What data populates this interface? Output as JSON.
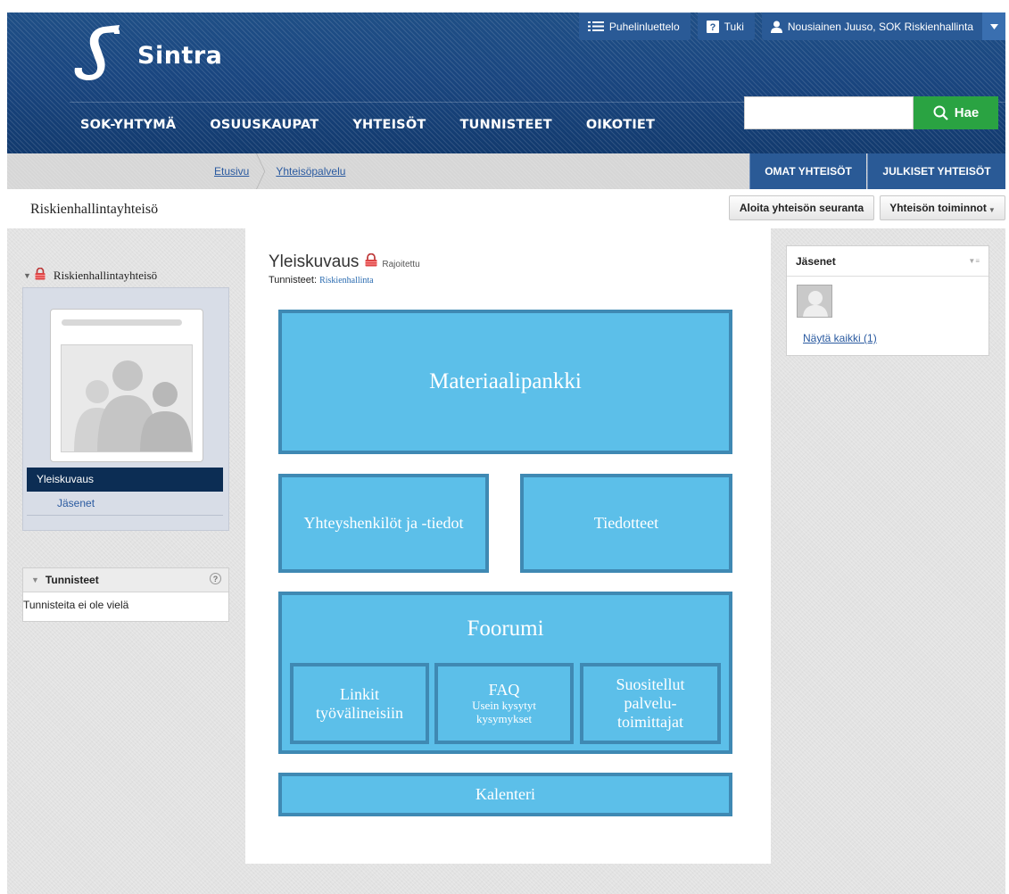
{
  "header": {
    "brand": "Sintra",
    "top_buttons": {
      "phonebook": {
        "label": "Puhelinluettelo",
        "icon": "list-icon"
      },
      "support": {
        "label": "Tuki",
        "icon": "help-icon"
      },
      "user": {
        "label": "Nousiainen Juuso, SOK Riskienhallinta",
        "icon": "user-icon"
      }
    },
    "nav": [
      {
        "label": "SOK-YHTYMÄ"
      },
      {
        "label": "OSUUSKAUPAT"
      },
      {
        "label": "YHTEISÖT"
      },
      {
        "label": "TUNNISTEET"
      },
      {
        "label": "OIKOTIET"
      }
    ],
    "search": {
      "placeholder": "",
      "value": "",
      "button_label": "Hae"
    }
  },
  "breadcrumb": [
    {
      "label": "Etusivu"
    },
    {
      "label": "Yhteisöpalvelu"
    }
  ],
  "tabs": {
    "own": "OMAT YHTEISÖT",
    "public": "JULKISET YHTEISÖT"
  },
  "page": {
    "title": "Riskienhallintayhteisö",
    "follow_button": "Aloita yhteisön seuranta",
    "actions_button": "Yhteisön toiminnot"
  },
  "left": {
    "community_name": "Riskienhallintayhteisö",
    "menu": [
      {
        "label": "Yleiskuvaus",
        "active": true
      },
      {
        "label": "Jäsenet",
        "active": false
      }
    ],
    "tags_box": {
      "title": "Tunnisteet",
      "help": "?",
      "empty_text": "Tunnisteita ei ole vielä"
    }
  },
  "center": {
    "title": "Yleiskuvaus",
    "restricted": "Rajoitettu",
    "tags_label": "Tunnisteet:",
    "tag": "Riskienhallinta",
    "tiles": {
      "materials": "Materiaalipankki",
      "contacts": "Yhteyshenkilöt ja -tiedot",
      "news": "Tiedotteet",
      "forum": "Foorumi",
      "links_l1": "Linkit",
      "links_l2": "työvälineisiin",
      "faq_l1": "FAQ",
      "faq_l2": "Usein kysytyt",
      "faq_l3": "kysymykset",
      "suppliers_l1": "Suositellut",
      "suppliers_l2": "palvelu-",
      "suppliers_l3": "toimittajat",
      "calendar": "Kalenteri"
    }
  },
  "right": {
    "members_title": "Jäsenet",
    "show_all": "Näytä kaikki (1)"
  },
  "colors": {
    "header_blue": "#1a4680",
    "nav_dark": "#0c2d54",
    "search_green": "#2aa342",
    "tile_fill": "#5cbfe9",
    "tile_border": "#3f89b3",
    "link_blue": "#2a5aa0"
  }
}
